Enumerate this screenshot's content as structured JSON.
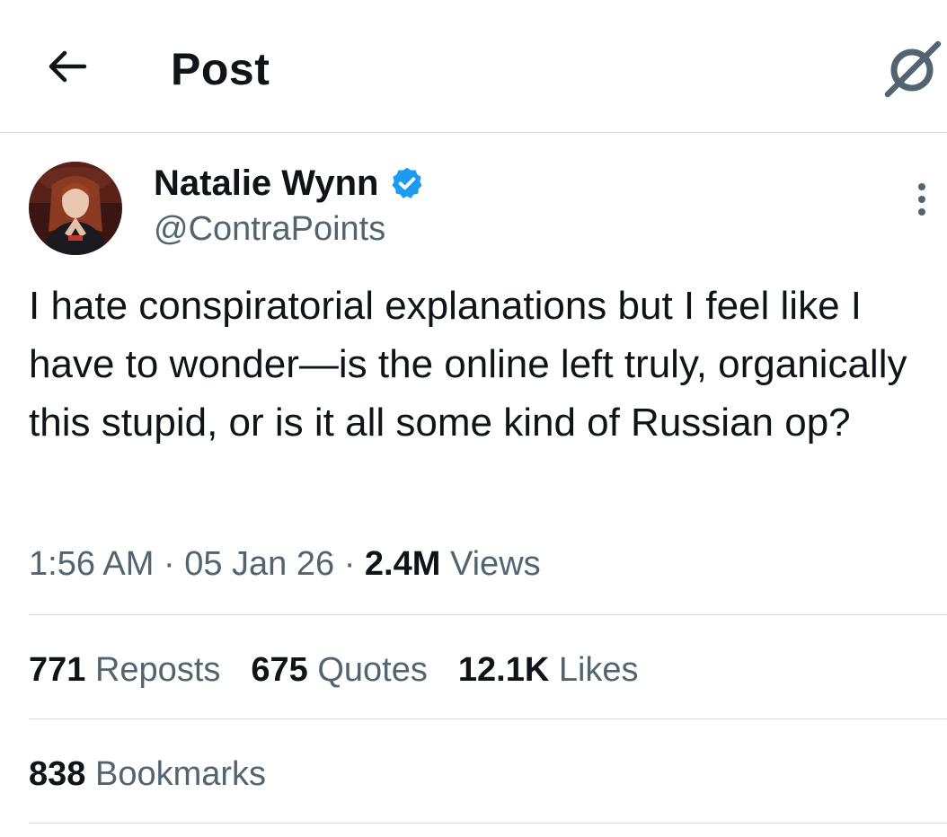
{
  "header": {
    "title": "Post",
    "back_icon": "arrow-left-icon",
    "grok_icon": "grok-slash-circle-icon"
  },
  "tweet": {
    "author": {
      "name": "Natalie Wynn",
      "handle": "@ContraPoints",
      "verified": true,
      "verified_color": "#1d9bf0"
    },
    "text": "I hate conspiratorial explanations but I feel like I have to wonder—is the online left truly, organically this stupid, or is it all some kind of Russian op?",
    "time": "1:56 AM",
    "date": "05 Jan 26",
    "separator": "·",
    "views_count": "2.4M",
    "views_label": "Views",
    "stats": {
      "reposts": {
        "count": "771",
        "label": "Reposts"
      },
      "quotes": {
        "count": "675",
        "label": "Quotes"
      },
      "likes": {
        "count": "12.1K",
        "label": "Likes"
      },
      "bookmarks": {
        "count": "838",
        "label": "Bookmarks"
      }
    }
  },
  "colors": {
    "text_primary": "#0f1419",
    "text_secondary": "#536471",
    "divider": "#d9dde1",
    "accent": "#1d9bf0"
  }
}
